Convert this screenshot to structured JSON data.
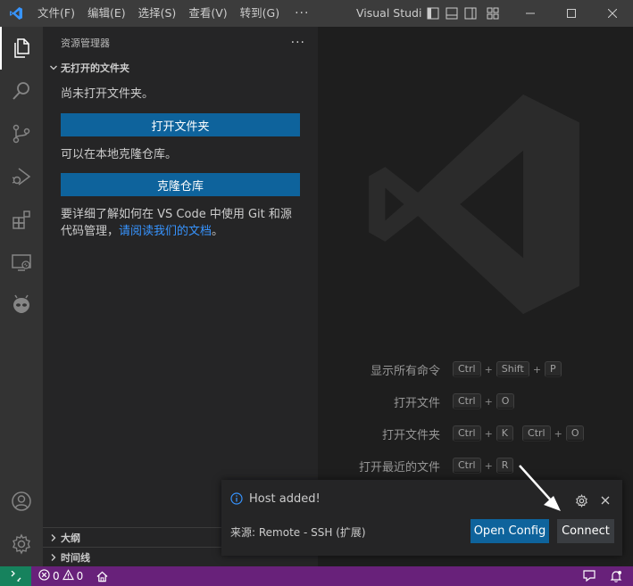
{
  "titlebar": {
    "menu": [
      "文件(F)",
      "编辑(E)",
      "选择(S)",
      "查看(V)",
      "转到(G)"
    ],
    "more": "···",
    "title": "Visual Studio Code"
  },
  "activitybar": {
    "items": [
      "explorer-icon",
      "search-icon",
      "source-control-icon",
      "run-debug-icon",
      "extensions-icon",
      "remote-explorer-icon",
      "alien-extension-icon"
    ],
    "bottom": [
      "account-icon",
      "settings-gear-icon"
    ]
  },
  "sidebar": {
    "title": "资源管理器",
    "more": "···",
    "section": "无打开的文件夹",
    "no_folder_text": "尚未打开文件夹。",
    "open_folder_button": "打开文件夹",
    "clone_text": "可以在本地克隆仓库。",
    "clone_button": "克隆仓库",
    "git_text_prefix": "要详细了解如何在 VS Code 中使用 Git 和源代码管理，",
    "git_link": "请阅读我们的文档",
    "git_text_suffix": "。",
    "outline": "大纲",
    "timeline": "时间线"
  },
  "editor": {
    "shortcuts": [
      {
        "label": "显示所有命令",
        "keys": [
          [
            "Ctrl",
            "Shift",
            "P"
          ]
        ]
      },
      {
        "label": "打开文件",
        "keys": [
          [
            "Ctrl",
            "O"
          ]
        ]
      },
      {
        "label": "打开文件夹",
        "keys": [
          [
            "Ctrl",
            "K"
          ],
          [
            "Ctrl",
            "O"
          ]
        ]
      },
      {
        "label": "打开最近的文件",
        "keys": [
          [
            "Ctrl",
            "R"
          ]
        ]
      }
    ]
  },
  "notification": {
    "message": "Host added!",
    "source": "来源: Remote - SSH (扩展)",
    "primary_button": "Open Config",
    "secondary_button": "Connect"
  },
  "statusbar": {
    "errors": "0",
    "warnings": "0"
  },
  "colors": {
    "statusbar": "#68217a",
    "remote": "#16825d",
    "button": "#0e639c",
    "link": "#3794ff"
  }
}
